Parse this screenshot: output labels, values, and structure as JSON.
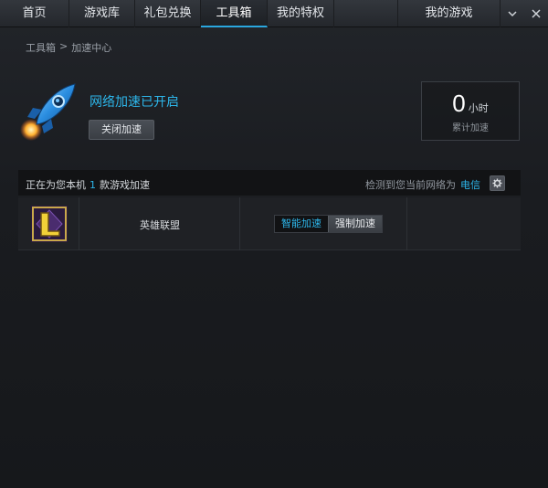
{
  "nav": {
    "tabs": [
      {
        "label": "首页"
      },
      {
        "label": "游戏库"
      },
      {
        "label": "礼包兑换"
      },
      {
        "label": "工具箱"
      },
      {
        "label": "我的特权"
      }
    ],
    "my_games": "我的游戏",
    "active_tab": "工具箱"
  },
  "breadcrumb": {
    "root": "工具箱",
    "separator": ">",
    "current": "加速中心"
  },
  "status": {
    "text": "网络加速已开启",
    "close_button": "关闭加速"
  },
  "hours": {
    "value": "0",
    "unit": "小时",
    "caption": "累计加速"
  },
  "accel_bar": {
    "prefix": "正在为您本机",
    "count": "1",
    "suffix": "款游戏加速",
    "detect_text": "检测到您当前网络为",
    "isp": "电信"
  },
  "game": {
    "name": "英雄联盟",
    "modes": {
      "smart": "智能加速",
      "force": "强制加速"
    }
  },
  "colors": {
    "accent": "#2db6ea",
    "background": "#1a1c20",
    "active_tab_underline": "#2aa7de"
  }
}
